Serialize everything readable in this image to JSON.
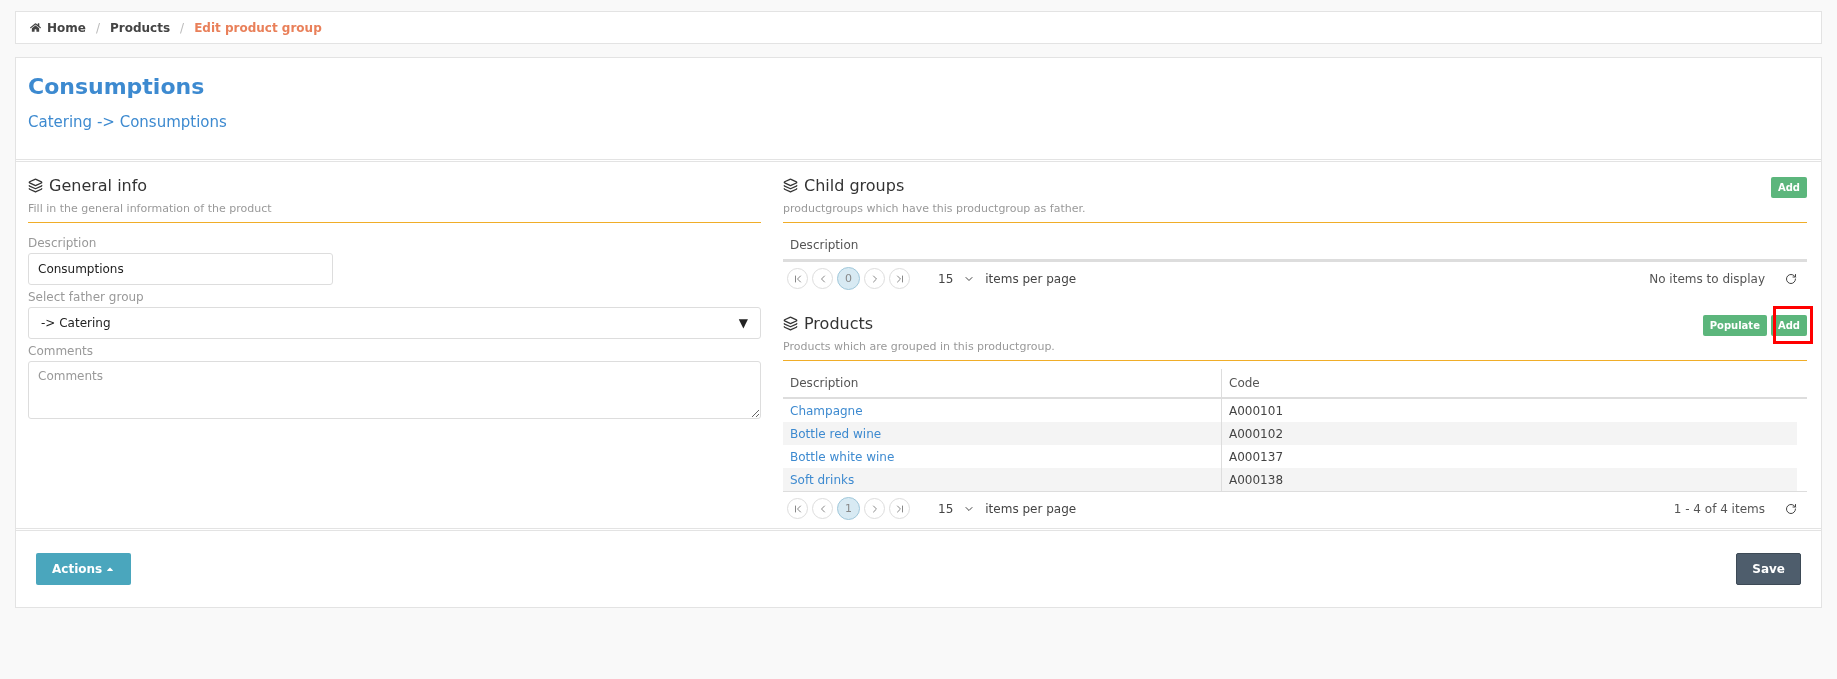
{
  "breadcrumb": [
    {
      "label": "Home",
      "kind": "home",
      "current": false
    },
    {
      "label": "Products",
      "kind": "link",
      "current": false
    },
    {
      "label": "Edit product group",
      "kind": "link",
      "current": true
    }
  ],
  "breadcrumb_separator": "/",
  "header": {
    "title": "Consumptions",
    "path": "Catering -> Consumptions"
  },
  "general_info": {
    "title": "General info",
    "subtitle": "Fill in the general information of the product",
    "fields": [
      {
        "kind": "text",
        "label": "Description",
        "value": "Consumptions"
      },
      {
        "kind": "select",
        "label": "Select father group",
        "value": "-> Catering",
        "arrow": "▼"
      },
      {
        "kind": "textarea",
        "label": "Comments",
        "placeholder": "Comments"
      }
    ]
  },
  "child_groups": {
    "title": "Child groups",
    "subtitle": "productgroups which have this productgroup as father.",
    "buttons": [
      {
        "label": "Add",
        "highlighted": false
      }
    ],
    "columns": [
      "Description"
    ],
    "pager": {
      "page": "0",
      "page_size": "15",
      "per_page_label": "items per page",
      "status": "No items to display"
    }
  },
  "products": {
    "title": "Products",
    "subtitle": "Products which are grouped in this productgroup.",
    "buttons": [
      {
        "label": "Populate",
        "highlighted": false
      },
      {
        "label": "Add",
        "highlighted": true
      }
    ],
    "columns": [
      "Description",
      "Code"
    ],
    "rows": [
      {
        "description": "Champagne",
        "code": "A000101"
      },
      {
        "description": "Bottle red wine",
        "code": "A000102"
      },
      {
        "description": "Bottle white wine",
        "code": "A000137"
      },
      {
        "description": "Soft drinks",
        "code": "A000138"
      }
    ],
    "pager": {
      "page": "1",
      "page_size": "15",
      "per_page_label": "items per page",
      "status": "1 - 4 of 4 items"
    }
  },
  "footer": {
    "actions": "Actions",
    "save": "Save"
  }
}
